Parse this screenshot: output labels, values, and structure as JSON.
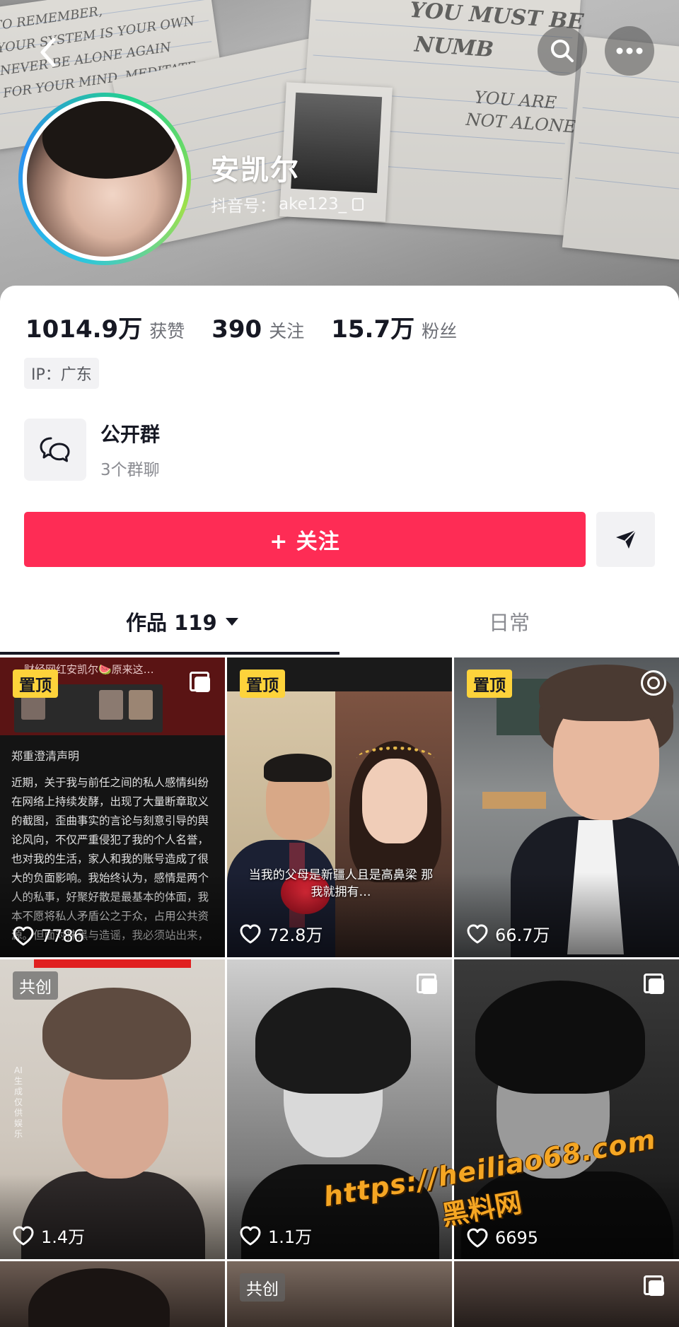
{
  "header": {
    "display_name": "安凯尔",
    "account_label": "抖音号：",
    "account_id": "ake123_"
  },
  "stats": [
    {
      "value": "1014.9万",
      "label": "获赞"
    },
    {
      "value": "390",
      "label": "关注"
    },
    {
      "value": "15.7万",
      "label": "粉丝"
    }
  ],
  "ip_tag": "IP：广东",
  "group": {
    "title": "公开群",
    "subtitle": "3个群聊"
  },
  "actions": {
    "follow_label": "+ 关注"
  },
  "tabs": [
    {
      "label": "作品 119",
      "active": true
    },
    {
      "label": "日常",
      "active": false
    }
  ],
  "posts": [
    {
      "badge": "置顶",
      "likes": "7786",
      "header_text": "财经网红安凯尔🍉原来这…",
      "statement_title": "郑重澄清声明",
      "statement_text": "近期，关于我与前任之间的私人感情纠纷在网络上持续发酵，出现了大量断章取义的截图，歪曲事实的言论与刻意引导的舆论风向，不仅严重侵犯了我的个人名誉，也对我的生活，家人和我的账号造成了很大的负面影响。我始终认为，感情是两个人的私事，好聚好散是最基本的体面，我本不愿将私人矛盾公之于众，占用公共资源。但面对抹黑与造谣，我必须站出来，"
    },
    {
      "badge": "置顶",
      "likes": "72.8万",
      "caption": "当我的父母是新疆人且是高鼻梁 那我就拥有…"
    },
    {
      "badge": "置顶",
      "likes": "66.7万"
    },
    {
      "badge": "共创",
      "likes": "1.4万"
    },
    {
      "badge": "",
      "likes": "1.1万"
    },
    {
      "badge": "",
      "likes": "6695"
    },
    {
      "badge": "",
      "likes": ""
    },
    {
      "badge": "共创",
      "likes": ""
    },
    {
      "badge": "",
      "likes": ""
    }
  ],
  "watermark": {
    "url": "https://heiliao68.com",
    "site_name": "黑料网"
  },
  "colors": {
    "follow_button": "#fe2c55",
    "pin_badge": "#fdd33b",
    "text_primary": "#161823",
    "text_secondary": "#8a8b91"
  }
}
